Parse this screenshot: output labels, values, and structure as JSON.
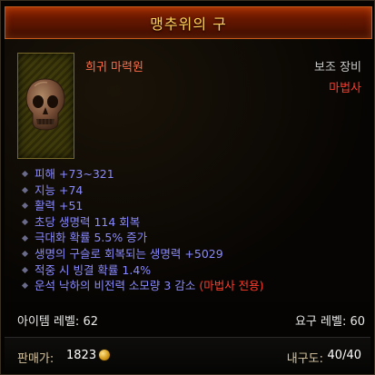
{
  "item": {
    "name": "맹추위의 구",
    "rarity": "희귀 마력원",
    "slot": "보조 장비",
    "class_requirement": "마법사",
    "icon": "skull-orb-icon"
  },
  "stats": [
    {
      "text": "피해 +73~321"
    },
    {
      "text": "지능 +74"
    },
    {
      "text": "활력 +51"
    },
    {
      "text": "초당 생명력 114 회복"
    },
    {
      "text": "극대화 확률 5.5% 증가"
    },
    {
      "text": "생명의 구슬로 회복되는 생명력 +5029"
    },
    {
      "text": "적중 시 빙결 확률 1.4%"
    },
    {
      "text": "운석 낙하의 비전력 소모량 3 감소",
      "class_only": "(마법사 전용)"
    }
  ],
  "levels": {
    "item_level": "아이템 레벨: 62",
    "required_level": "요구 레벨: 60"
  },
  "footer": {
    "price_label": "판매가:",
    "price_value": "1823",
    "currency_icon": "gold-coin-icon",
    "durability_label": "내구도:",
    "durability_value": "40/40"
  },
  "colors": {
    "header_bg": "#6a1800",
    "title": "#ffd25a",
    "rarity": "#ff6e4a",
    "class_requirement": "#ff3a2a",
    "stat": "#8a8aff"
  }
}
